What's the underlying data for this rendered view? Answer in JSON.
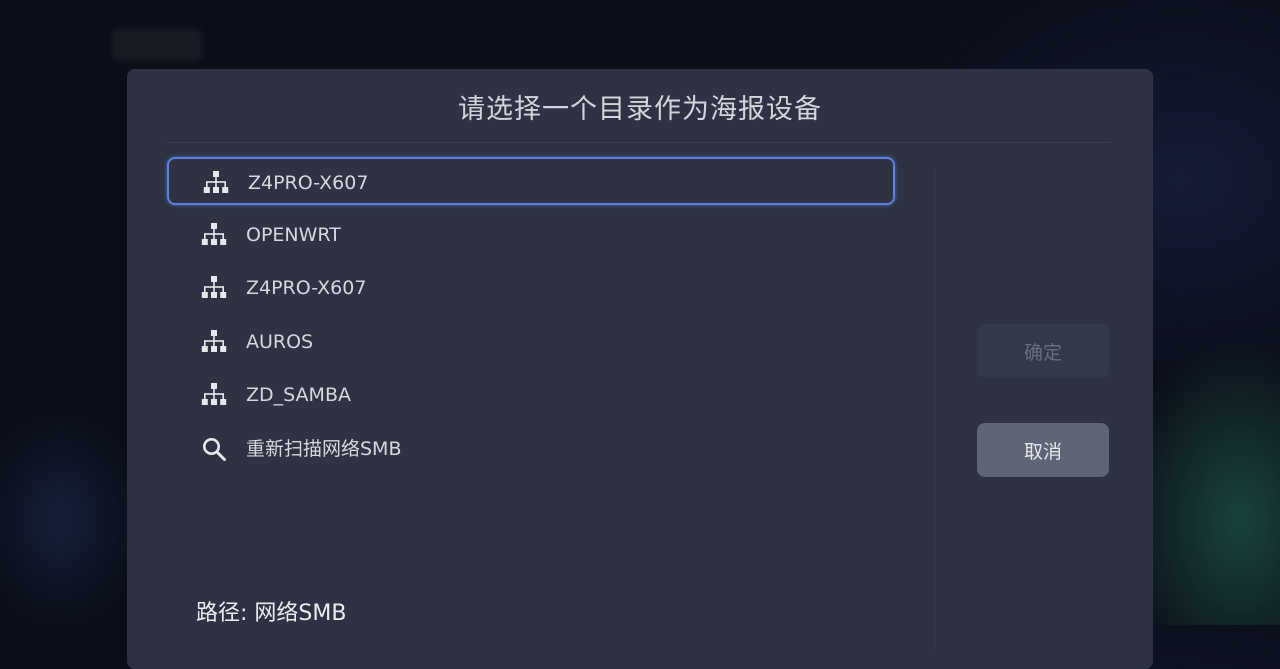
{
  "dialog": {
    "title": "请选择一个目录作为海报设备",
    "items": [
      {
        "label": "Z4PRO-X607",
        "icon": "network-tree-icon"
      },
      {
        "label": "OPENWRT",
        "icon": "network-tree-icon"
      },
      {
        "label": "Z4PRO-X607",
        "icon": "network-tree-icon"
      },
      {
        "label": "AUROS",
        "icon": "network-tree-icon"
      },
      {
        "label": "ZD_SAMBA",
        "icon": "network-tree-icon"
      },
      {
        "label": "重新扫描网络SMB",
        "icon": "search-icon"
      }
    ],
    "selected_index": 0,
    "path_text": "路径: 网络SMB",
    "confirm_label": "确定",
    "cancel_label": "取消"
  },
  "colors": {
    "dialog_bg": "#2e3242",
    "focus_border": "#5b82e0",
    "cancel_bg": "#5f6575"
  }
}
